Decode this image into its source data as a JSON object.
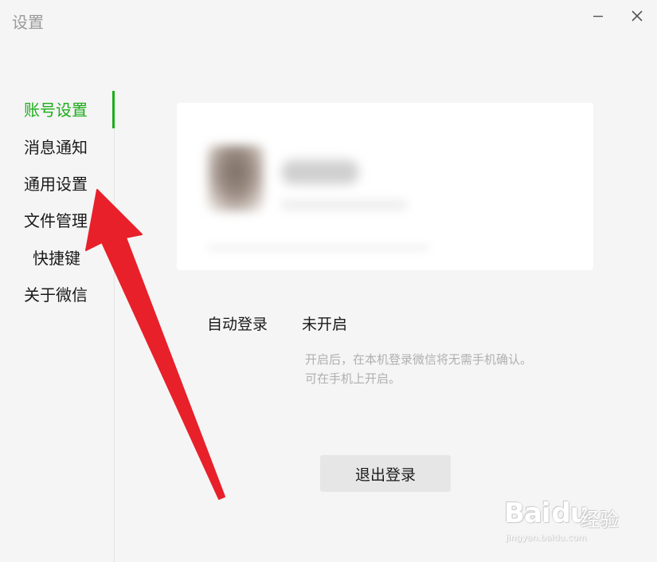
{
  "window": {
    "title": "设置",
    "minimize_icon": "minimize-icon",
    "close_icon": "close-icon"
  },
  "sidebar": {
    "items": [
      {
        "label": "账号设置",
        "active": true
      },
      {
        "label": "消息通知",
        "active": false
      },
      {
        "label": "通用设置",
        "active": false
      },
      {
        "label": "文件管理",
        "active": false
      },
      {
        "label": "快捷键",
        "active": false
      },
      {
        "label": "关于微信",
        "active": false
      }
    ]
  },
  "account": {
    "auto_login_label": "自动登录",
    "auto_login_value": "未开启",
    "hint_line1": "开启后，在本机登录微信将无需手机确认。",
    "hint_line2": "可在手机上开启。",
    "logout_label": "退出登录"
  },
  "colors": {
    "accent": "#1aad19",
    "background": "#f5f5f5",
    "card": "#ffffff",
    "annotation_arrow": "#e8202a"
  },
  "watermark": {
    "logo": "Bai du 经验",
    "url": "jingyan.baidu.com"
  }
}
